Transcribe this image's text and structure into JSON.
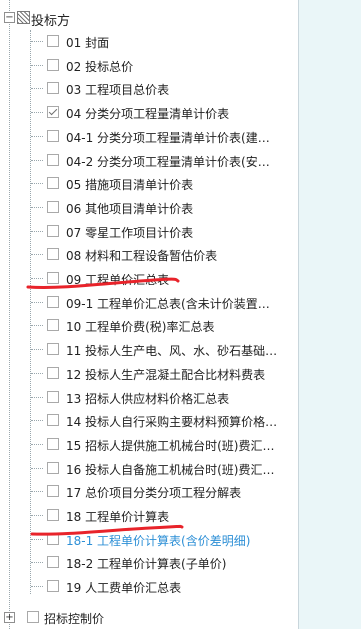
{
  "tree": {
    "root": {
      "label": "投标方",
      "expanded": true
    },
    "items": [
      {
        "label": "01  封面",
        "checked": false,
        "highlight": false
      },
      {
        "label": "02  投标总价",
        "checked": false,
        "highlight": false
      },
      {
        "label": "03  工程项目总价表",
        "checked": false,
        "highlight": false
      },
      {
        "label": "04  分类分项工程量清单计价表",
        "checked": true,
        "highlight": false
      },
      {
        "label": "04-1  分类分项工程量清单计价表(建…",
        "checked": false,
        "highlight": false
      },
      {
        "label": "04-2  分类分项工程量清单计价表(安…",
        "checked": false,
        "highlight": false
      },
      {
        "label": "05  措施项目清单计价表",
        "checked": false,
        "highlight": false
      },
      {
        "label": "06  其他项目清单计价表",
        "checked": false,
        "highlight": false
      },
      {
        "label": "07  零星工作项目计价表",
        "checked": false,
        "highlight": false
      },
      {
        "label": "08  材料和工程设备暂估价表",
        "checked": false,
        "highlight": false
      },
      {
        "label": "09  工程单价汇总表",
        "checked": false,
        "highlight": false
      },
      {
        "label": "09-1  工程单价汇总表(含未计价装置…",
        "checked": false,
        "highlight": false
      },
      {
        "label": "10  工程单价费(税)率汇总表",
        "checked": false,
        "highlight": false
      },
      {
        "label": "11  投标人生产电、风、水、砂石基础…",
        "checked": false,
        "highlight": false
      },
      {
        "label": "12  投标人生产混凝土配合比材料费表",
        "checked": false,
        "highlight": false
      },
      {
        "label": "13  招标人供应材料价格汇总表",
        "checked": false,
        "highlight": false
      },
      {
        "label": "14  投标人自行采购主要材料预算价格…",
        "checked": false,
        "highlight": false
      },
      {
        "label": "15  招标人提供施工机械台时(班)费汇…",
        "checked": false,
        "highlight": false
      },
      {
        "label": "16  投标人自备施工机械台时(班)费汇…",
        "checked": false,
        "highlight": false
      },
      {
        "label": "17  总价项目分类分项工程分解表",
        "checked": false,
        "highlight": false
      },
      {
        "label": "18  工程单价计算表",
        "checked": false,
        "highlight": false
      },
      {
        "label": "18-1  工程单价计算表(含价差明细)",
        "checked": false,
        "highlight": true
      },
      {
        "label": "18-2  工程单价计算表(子单价)",
        "checked": false,
        "highlight": false
      },
      {
        "label": "19  人工费单价汇总表",
        "checked": false,
        "highlight": false
      }
    ],
    "bottom": {
      "label": "招标控制价",
      "expanded": false,
      "toggle_symbol": "+"
    }
  },
  "colors": {
    "link": "#2d8fd6",
    "annotation": "#e8232a",
    "panel_bg": "#ffffff",
    "outer_bg": "#eaf6f8"
  },
  "annotations": [
    {
      "name": "underline-item-09",
      "target_index": 10
    },
    {
      "name": "underline-item-18",
      "target_index": 20
    }
  ]
}
